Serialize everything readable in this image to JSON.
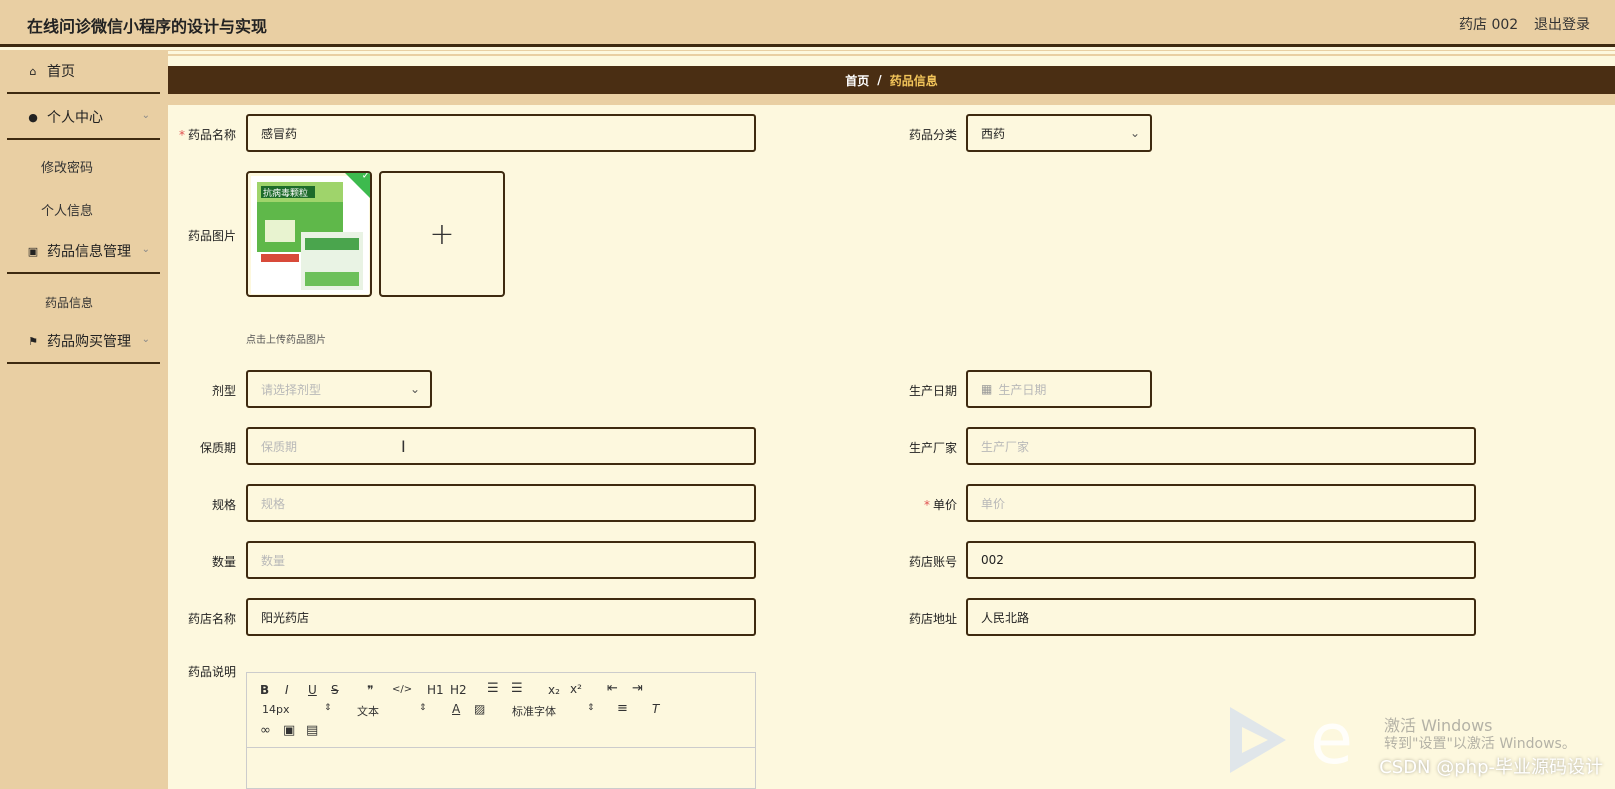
{
  "app": {
    "title": "在线问诊微信小程序的设计与实现",
    "user": "药店 002",
    "logout": "退出登录"
  },
  "sidebar": {
    "home": "首页",
    "personal_center": "个人中心",
    "change_password": "修改密码",
    "personal_info": "个人信息",
    "drug_info_mgmt": "药品信息管理",
    "drug_info": "药品信息",
    "drug_purchase_mgmt": "药品购买管理"
  },
  "breadcrumb": {
    "home": "首页",
    "sep": "/",
    "current": "药品信息"
  },
  "form": {
    "name": {
      "label": "药品名称",
      "value": "感冒药",
      "required": true
    },
    "category": {
      "label": "药品分类",
      "value": "西药"
    },
    "image": {
      "label": "药品图片",
      "hint": "点击上传药品图片",
      "thumb_text": "抗病毒颗粒"
    },
    "dosage": {
      "label": "剂型",
      "placeholder": "请选择剂型"
    },
    "production_date": {
      "label": "生产日期",
      "placeholder": "生产日期"
    },
    "shelf_life": {
      "label": "保质期",
      "placeholder": "保质期"
    },
    "manufacturer": {
      "label": "生产厂家",
      "placeholder": "生产厂家"
    },
    "spec": {
      "label": "规格",
      "placeholder": "规格"
    },
    "price": {
      "label": "单价",
      "placeholder": "单价",
      "required": true
    },
    "quantity": {
      "label": "数量",
      "placeholder": "数量"
    },
    "store_account": {
      "label": "药店账号",
      "value": "002"
    },
    "store_name": {
      "label": "药店名称",
      "value": "阳光药店"
    },
    "store_address": {
      "label": "药店地址",
      "value": "人民北路"
    },
    "description": {
      "label": "药品说明"
    }
  },
  "editor": {
    "font_size": "14px",
    "header": "文本",
    "font": "标准字体",
    "buttons": {
      "bold": "B",
      "italic": "I",
      "underline": "U",
      "strike": "S",
      "quote": "❞",
      "code": "</>",
      "h1": "H1",
      "h2": "H2",
      "sub": "x₂",
      "sup": "x²"
    }
  },
  "watermark": {
    "csdn": "CSDN @php-毕业源码设计",
    "activate1": "激活 Windows",
    "activate2": "转到\"设置\"以激活 Windows。"
  },
  "colors": {
    "header_bg": "#e9cfa3",
    "page_bg": "#fdf8de",
    "dark_brown": "#4a2e13",
    "accent": "#f3c55a"
  }
}
